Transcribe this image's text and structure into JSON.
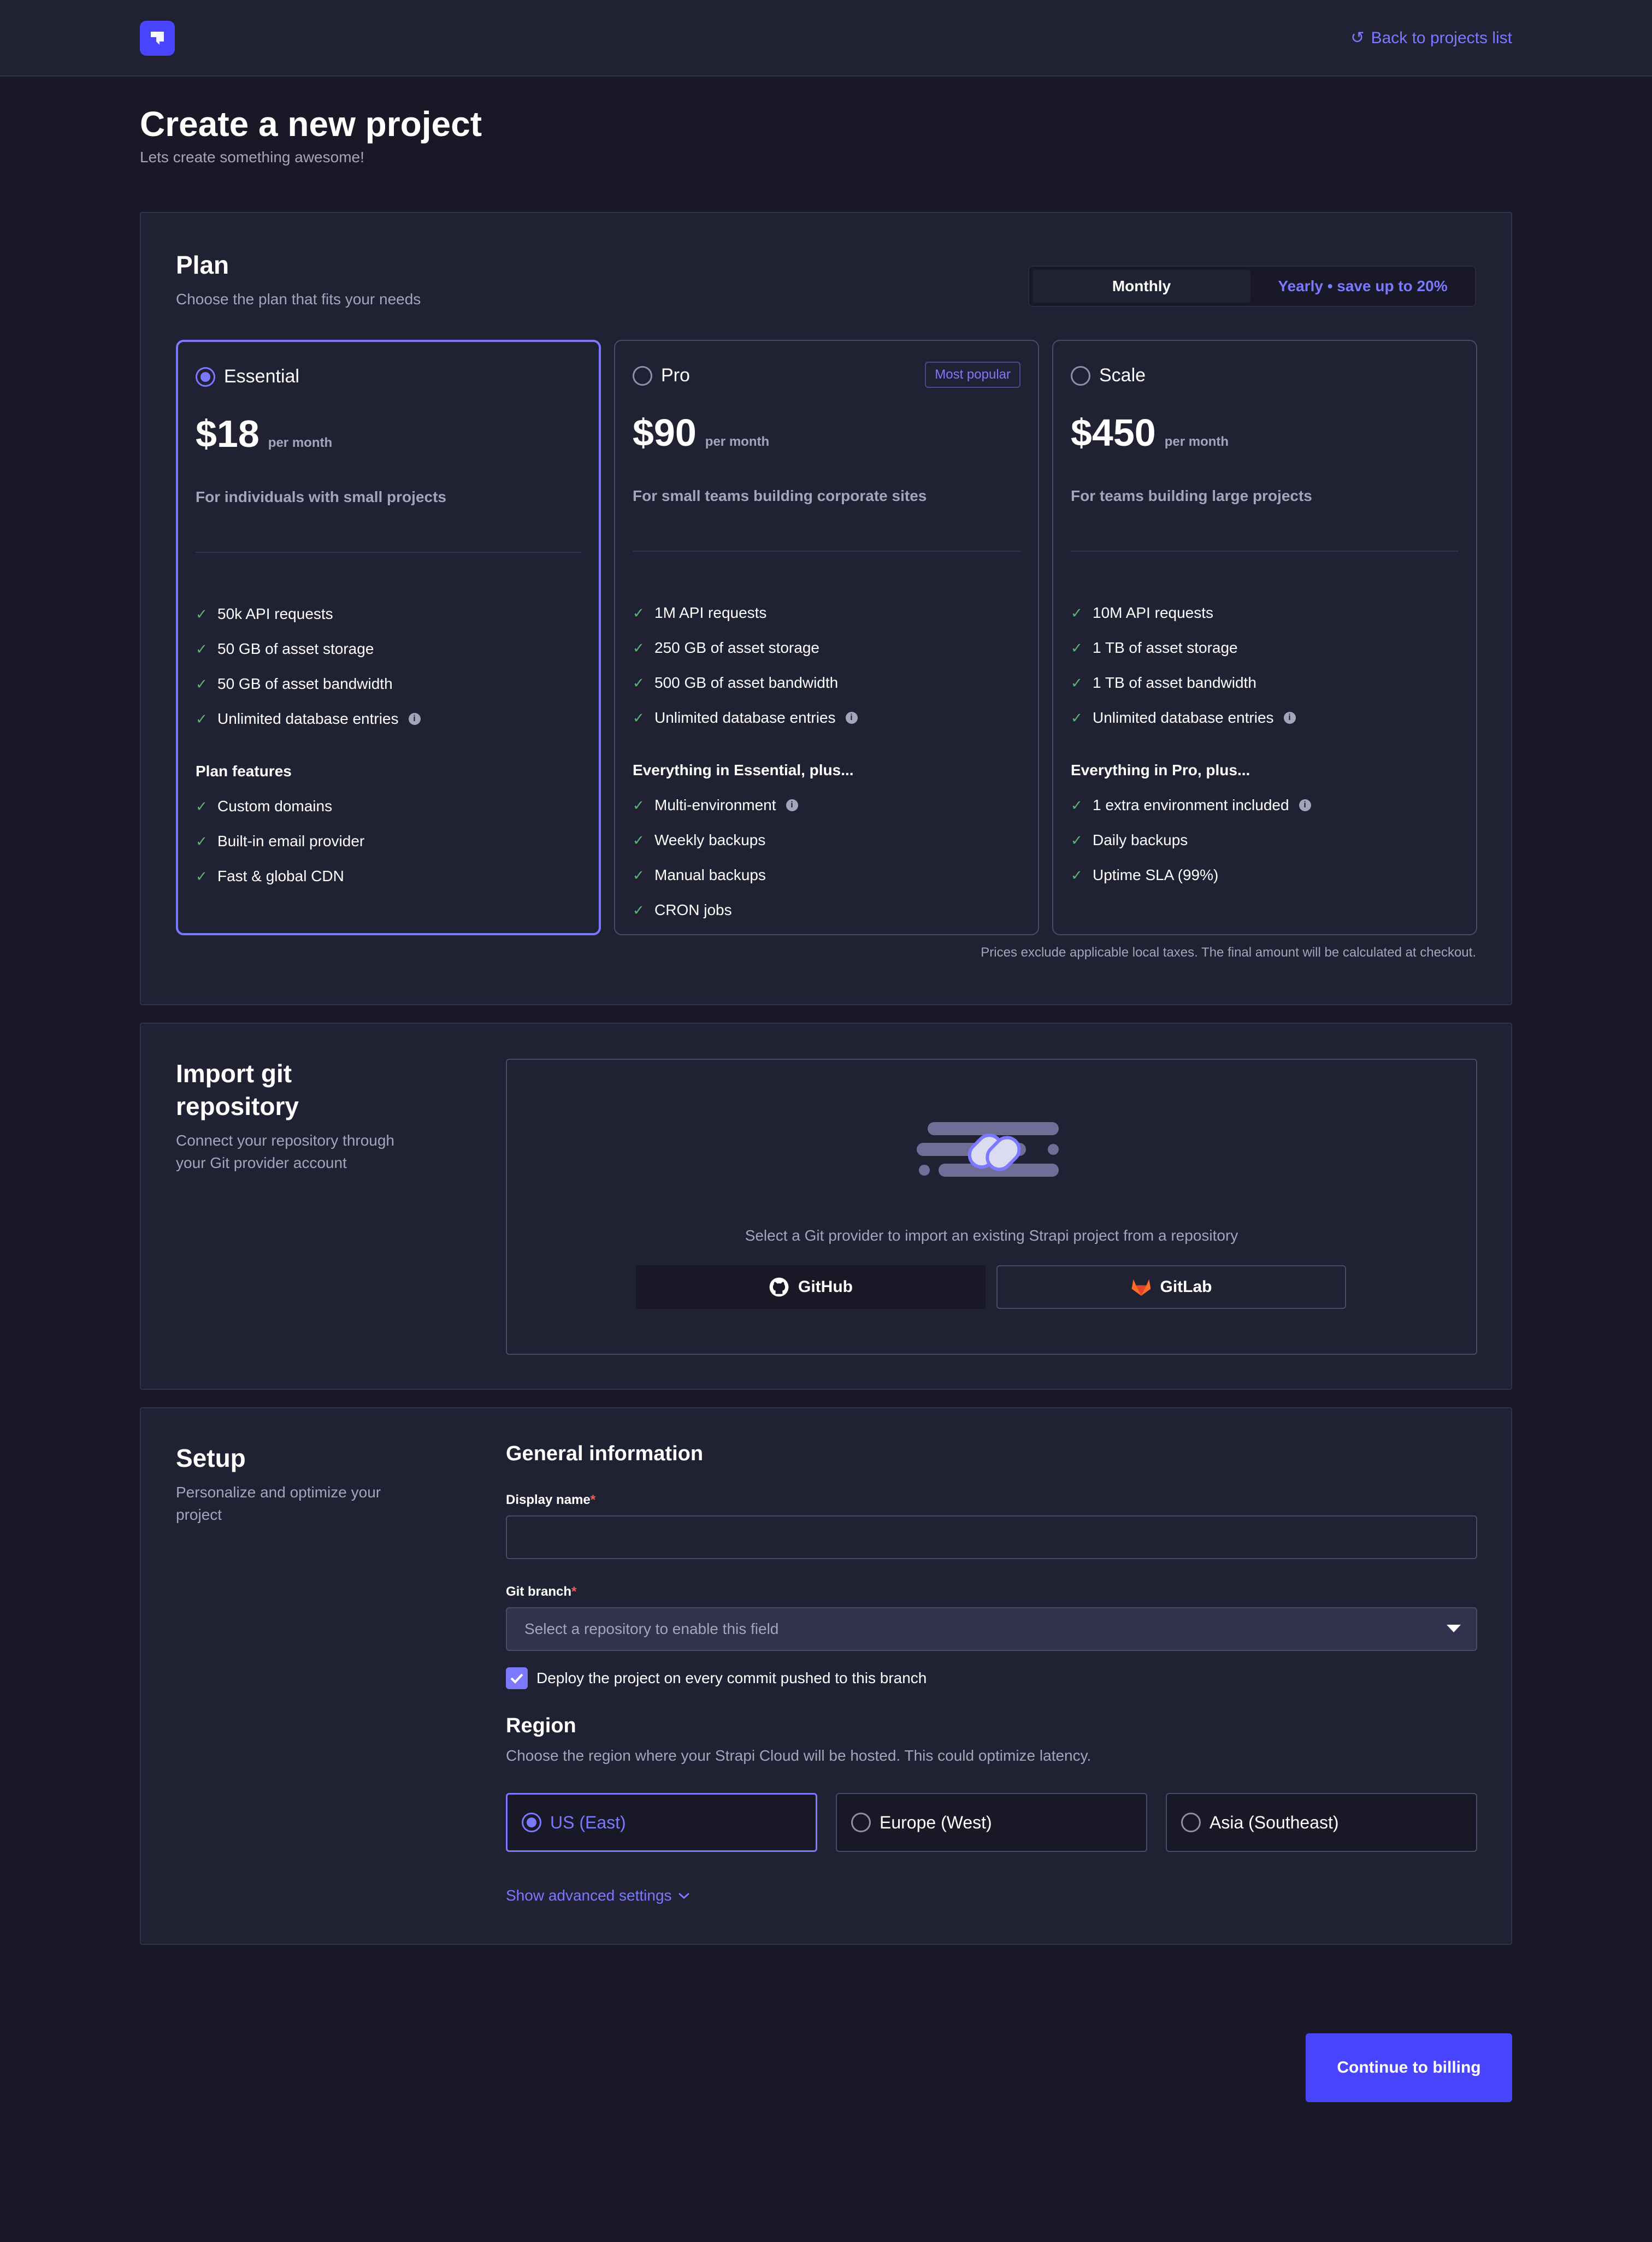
{
  "header": {
    "back_label": "Back to projects list"
  },
  "page": {
    "title": "Create a new project",
    "subtitle": "Lets create something awesome!"
  },
  "plan": {
    "title": "Plan",
    "subtitle": "Choose the plan that fits your needs",
    "billing": {
      "monthly": "Monthly",
      "yearly": "Yearly • save up to 20%",
      "selected": "Monthly"
    },
    "cards": [
      {
        "name": "Essential",
        "price": "$18",
        "period": "per month",
        "description": "For individuals with small projects",
        "selected": true,
        "badge": "",
        "limits": [
          "50k API requests",
          "50 GB of asset storage",
          "50 GB of asset bandwidth",
          "Unlimited database entries"
        ],
        "features_title": "Plan features",
        "features": [
          "Custom domains",
          "Built-in email provider",
          "Fast & global CDN"
        ]
      },
      {
        "name": "Pro",
        "price": "$90",
        "period": "per month",
        "description": "For small teams building corporate sites",
        "selected": false,
        "badge": "Most popular",
        "limits": [
          "1M API requests",
          "250 GB of asset storage",
          "500 GB of asset bandwidth",
          "Unlimited database entries"
        ],
        "features_title": "Everything in Essential, plus...",
        "features": [
          "Multi-environment",
          "Weekly backups",
          "Manual backups",
          "CRON jobs"
        ]
      },
      {
        "name": "Scale",
        "price": "$450",
        "period": "per month",
        "description": "For teams building large projects",
        "selected": false,
        "badge": "",
        "limits": [
          "10M API requests",
          "1 TB of asset storage",
          "1 TB of asset bandwidth",
          "Unlimited database entries"
        ],
        "features_title": "Everything in Pro, plus...",
        "features": [
          "1 extra environment included",
          "Daily backups",
          "Uptime SLA (99%)"
        ]
      }
    ],
    "tax_note": "Prices exclude applicable local taxes. The final amount will be calculated at checkout."
  },
  "git": {
    "title": "Import git repository",
    "subtitle": "Connect your repository through your Git provider account",
    "prompt": "Select a Git provider to import an existing Strapi project from a repository",
    "github": "GitHub",
    "gitlab": "GitLab"
  },
  "setup": {
    "title": "Setup",
    "subtitle": "Personalize and optimize your project",
    "general_title": "General information",
    "display_name_label": "Display name",
    "display_name_value": "",
    "git_branch_label": "Git branch",
    "git_branch_placeholder": "Select a repository to enable this field",
    "deploy_label": "Deploy the project on every commit pushed to this branch",
    "deploy_checked": true,
    "region_title": "Region",
    "region_subtitle": "Choose the region where your Strapi Cloud will be hosted. This could optimize latency.",
    "regions": [
      {
        "label": "US (East)",
        "selected": true
      },
      {
        "label": "Europe (West)",
        "selected": false
      },
      {
        "label": "Asia (Southeast)",
        "selected": false
      }
    ],
    "advanced_label": "Show advanced settings"
  },
  "footer": {
    "continue_label": "Continue to billing"
  },
  "colors": {
    "accent": "#7b79ff",
    "primary_button": "#4945ff",
    "check": "#5cb176",
    "required": "#ee5e52"
  }
}
